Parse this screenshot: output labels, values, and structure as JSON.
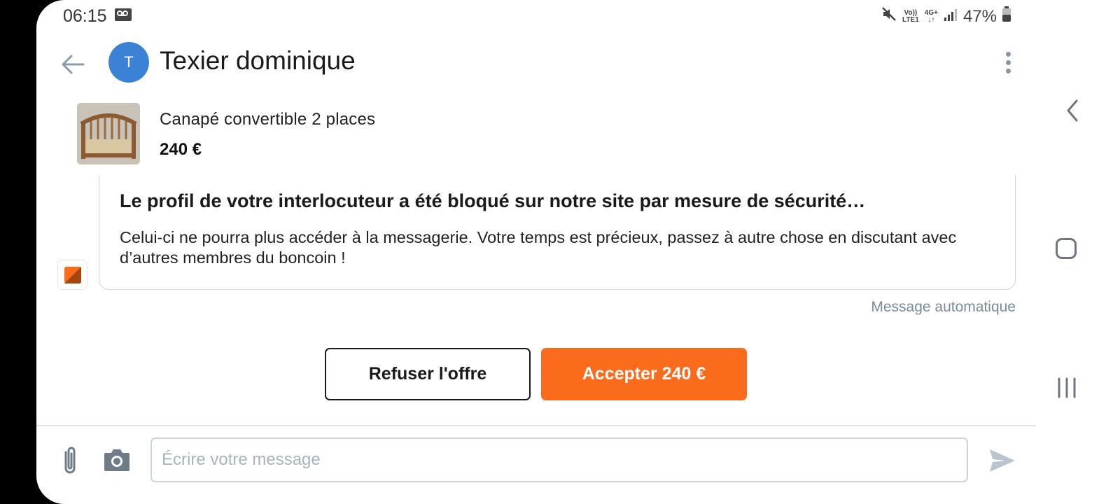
{
  "status_bar": {
    "time": "06:15",
    "network_top": "Vo))",
    "network_bottom": "LTE1",
    "network_type": "4G+",
    "battery": "47%"
  },
  "header": {
    "avatar_initial": "T",
    "contact_name": "Texier dominique"
  },
  "listing": {
    "title": "Canapé convertible 2 places",
    "price": "240 €"
  },
  "system_message": {
    "title": "Le profil de votre interlocuteur a été bloqué sur notre site par mesure de sécurité…",
    "body": "Celui-ci ne pourra plus accéder à la messagerie. Votre temps est précieux, passez à autre chose en discutant avec d’autres membres du boncoin !",
    "label": "Message automatique"
  },
  "offer": {
    "refuse_label": "Refuser l'offre",
    "accept_label": "Accepter 240 €"
  },
  "composer": {
    "placeholder": "Écrire votre message"
  },
  "colors": {
    "accent": "#fb6b1c",
    "avatar": "#3b82d6",
    "muted_text": "#7c8b9a"
  }
}
